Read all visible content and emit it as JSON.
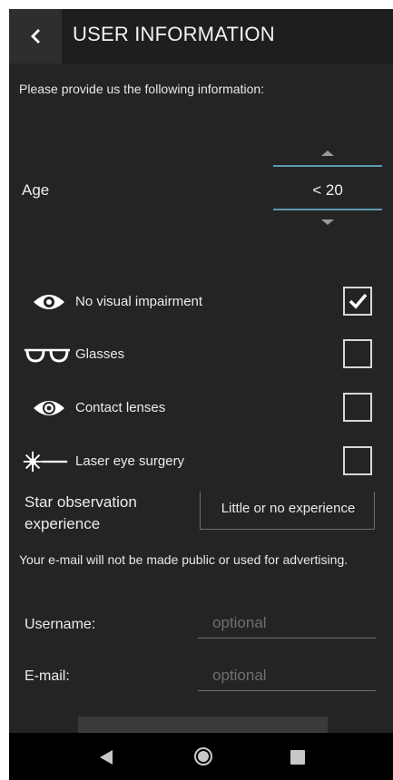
{
  "header": {
    "title": "USER INFORMATION",
    "back_icon": "chevron-left-icon"
  },
  "intro": "Please provide us the following information:",
  "age": {
    "label": "Age",
    "value": "< 20"
  },
  "impairments": [
    {
      "icon": "eye-icon",
      "label": "No visual impairment",
      "checked": true
    },
    {
      "icon": "glasses-icon",
      "label": "Glasses",
      "checked": false
    },
    {
      "icon": "contact-lens-icon",
      "label": "Contact lenses",
      "checked": false
    },
    {
      "icon": "laser-icon",
      "label": "Laser eye surgery",
      "checked": false
    }
  ],
  "experience": {
    "label": "Star observation experience",
    "value": "Little or no experience"
  },
  "notice": "Your e-mail will not be made public or used for advertising.",
  "username": {
    "label": "Username:",
    "placeholder": "optional"
  },
  "email": {
    "label": "E-mail:",
    "placeholder": "optional"
  },
  "colors": {
    "background": "#242424",
    "appbar": "#1e1e1e",
    "accent": "#5b9bb5",
    "navbar": "#000000"
  }
}
